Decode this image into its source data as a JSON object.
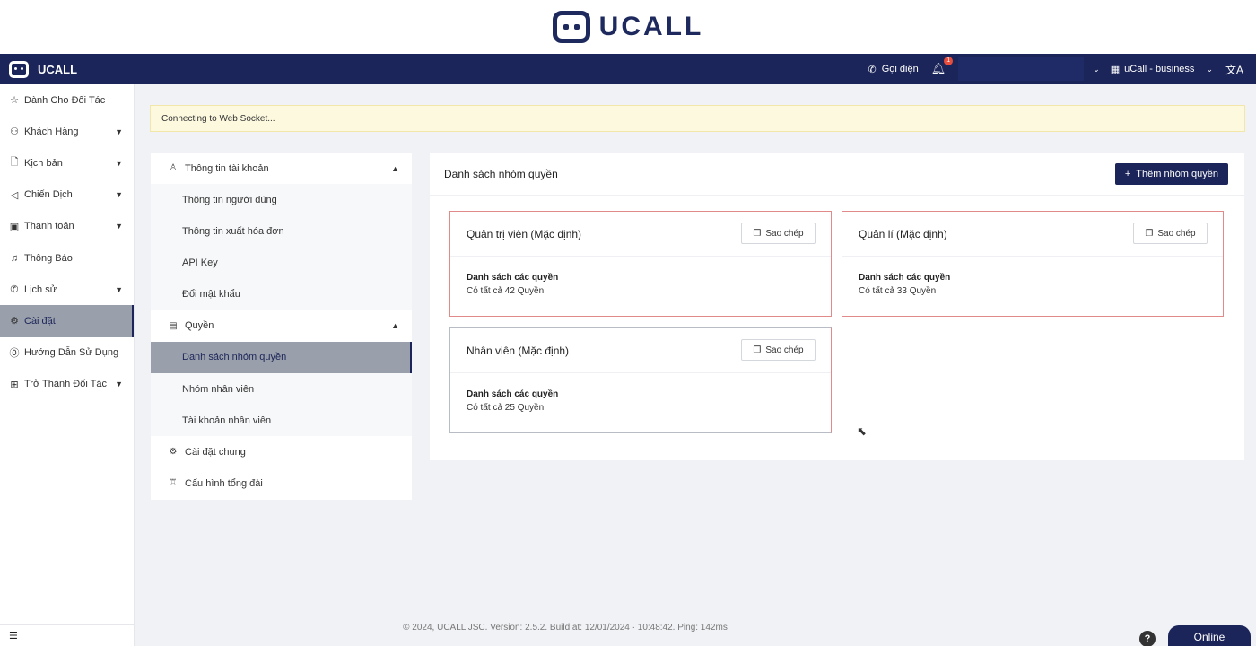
{
  "banner": {
    "brand": "UCALL"
  },
  "navbar": {
    "brand": "UCALL",
    "call_label": "Gọi điện",
    "notification_count": "1",
    "org_label": "uCall - business"
  },
  "sidebar": {
    "items": [
      {
        "label": "Dành Cho Đối Tác",
        "icon": "star-icon"
      },
      {
        "label": "Khách Hàng",
        "icon": "users-icon"
      },
      {
        "label": "Kịch bản",
        "icon": "document-icon"
      },
      {
        "label": "Chiến Dịch",
        "icon": "megaphone-icon"
      },
      {
        "label": "Thanh toán",
        "icon": "wallet-icon"
      },
      {
        "label": "Thông Báo",
        "icon": "bell-icon"
      },
      {
        "label": "Lịch sử",
        "icon": "phone-history-icon"
      },
      {
        "label": "Cài đặt",
        "icon": "gear-icon"
      },
      {
        "label": "Hướng Dẫn Sử Dụng",
        "icon": "help-icon"
      },
      {
        "label": "Trở Thành Đối Tác",
        "icon": "gift-icon"
      }
    ]
  },
  "ws_status": "Connecting to Web Socket...",
  "settings_menu": {
    "account": {
      "label": "Thông tin tài khoản",
      "items": [
        "Thông tin người dùng",
        "Thông tin xuất hóa đơn",
        "API Key",
        "Đổi mật khẩu"
      ]
    },
    "permissions": {
      "label": "Quyền",
      "items": [
        "Danh sách nhóm quyền",
        "Nhóm nhân viên",
        "Tài khoản nhân viên"
      ]
    },
    "general": "Cài đặt chung",
    "pbx": "Cấu hình tổng đài"
  },
  "content": {
    "title": "Danh sách nhóm quyền",
    "add_button": "Thêm nhóm quyền",
    "copy_label": "Sao chép",
    "perm_label": "Danh sách các quyền",
    "cards": [
      {
        "title": "Quản trị viên (Mặc định)",
        "count": "Có tất cả 42 Quyền"
      },
      {
        "title": "Quản lí (Mặc định)",
        "count": "Có tất cả 33 Quyền"
      },
      {
        "title": "Nhân viên (Mặc định)",
        "count": "Có tất cả 25 Quyền"
      }
    ]
  },
  "footer": "© 2024, UCALL JSC. Version: 2.5.2. Build at: 12/01/2024 · 10:48:42. Ping: 142ms",
  "online_label": "Online",
  "help_label": "?",
  "colors": {
    "primary": "#1b2559",
    "card_border": "#e08a8a",
    "ws_bg": "#fdf9df",
    "active_bg": "#9aa0ab"
  }
}
